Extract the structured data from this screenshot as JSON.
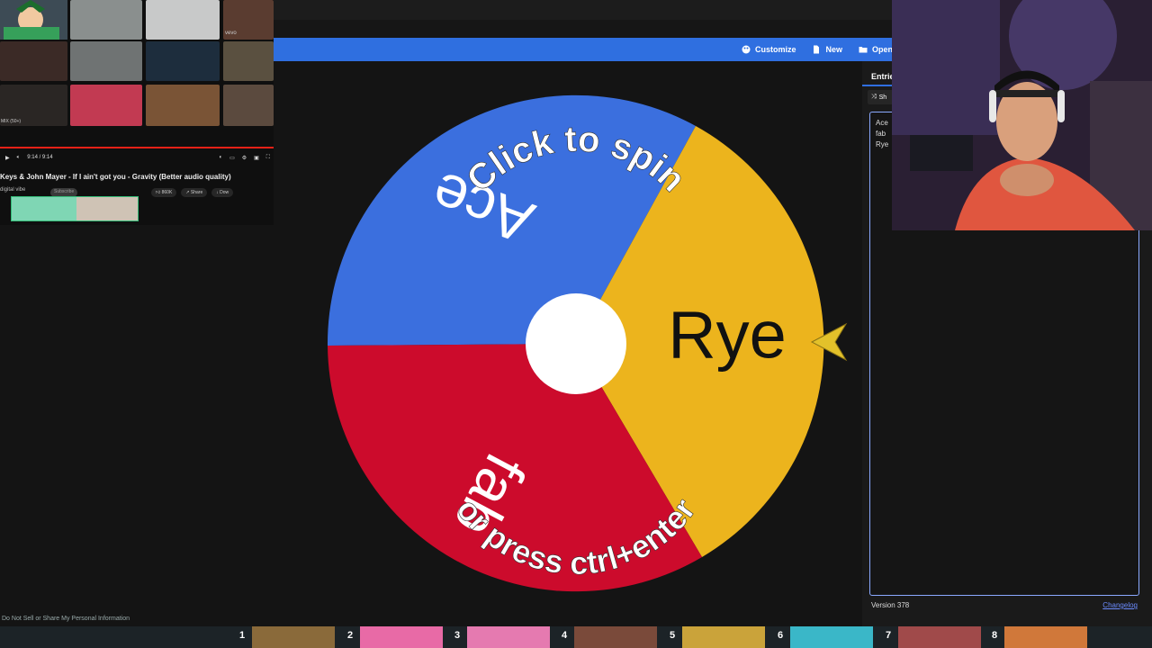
{
  "toolbar": {
    "customize_label": "Customize",
    "new_label": "New",
    "open_label": "Open"
  },
  "wheel": {
    "prompt_top": "Click to spin",
    "prompt_bottom": "or press ctrl+enter",
    "segments": [
      {
        "label": "Ace",
        "color": "#3b6fde"
      },
      {
        "label": "Rye",
        "color": "#ecb41d"
      },
      {
        "label": "fab",
        "color": "#cc0b2c"
      }
    ],
    "pointer_color": "#e3c12a"
  },
  "panel": {
    "tab_entries": "Entries",
    "shuffle_label": "Sh",
    "entries": [
      "Ace",
      "fab",
      "Rye"
    ],
    "version": "Version 378",
    "changelog": "Changelog"
  },
  "youtube": {
    "time": "9:14 / 9:14",
    "title": "Keys & John Mayer - If I ain't got you - Gravity (Better audio quality)",
    "channel": "digital vibe",
    "subscribe": "Subscribe",
    "likes": "860K",
    "share": "Share",
    "download": "Dow",
    "thumb_badge": "vevo",
    "mix_label": "MIX (50+)"
  },
  "footer": {
    "privacy": "Do Not Sell or Share My Personal Information",
    "game_numbers": [
      "1",
      "2",
      "3",
      "4",
      "5",
      "6",
      "7",
      "8"
    ]
  }
}
